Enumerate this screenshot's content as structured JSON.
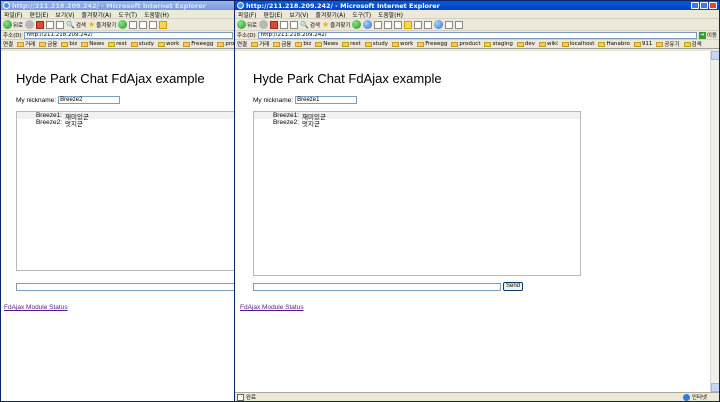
{
  "windows": [
    {
      "id": "back",
      "title": "http://211.218.209.242/ - Microsoft Internet Explorer",
      "menu": [
        "파일(F)",
        "편집(E)",
        "보기(V)",
        "즐겨찾기(A)",
        "도구(T)",
        "도움말(H)"
      ],
      "toolbar": {
        "back_label": "뒤로",
        "search_label": "검색",
        "favorites_label": "즐겨찾기"
      },
      "address": {
        "label": "주소(D)",
        "url": "http://211.218.209.242/"
      },
      "links": {
        "label": "연결",
        "items": [
          "거래",
          "금융",
          "biz",
          "News",
          "rest",
          "study",
          "work",
          "Freeegg",
          "product"
        ]
      },
      "page": {
        "heading": "Hyde Park Chat FdAjax example",
        "nickname_label": "My nickname:",
        "nickname_value": "Breeze2",
        "messages": [
          {
            "who": "Breeze1:",
            "text": "재미있군"
          },
          {
            "who": "Breeze2:",
            "text": "멋지군"
          }
        ],
        "status_link": "FdAjax Module Status"
      }
    },
    {
      "id": "front",
      "title": "http://211.218.209.242/ - Microsoft Internet Explorer",
      "menu": [
        "파일(F)",
        "편집(E)",
        "보기(V)",
        "즐겨찾기(A)",
        "도구(T)",
        "도움말(H)"
      ],
      "toolbar": {
        "back_label": "뒤로",
        "search_label": "검색",
        "favorites_label": "즐겨찾기"
      },
      "address": {
        "label": "주소(D)",
        "url": "http://211.218.209.242/",
        "go_label": "이동"
      },
      "links": {
        "label": "연결",
        "items": [
          "거래",
          "금융",
          "biz",
          "News",
          "rest",
          "study",
          "work",
          "Freeegg",
          "product",
          "staging",
          "dev",
          "wiki",
          "localhost",
          "Hanabro",
          "911",
          "공유기",
          "검색"
        ]
      },
      "page": {
        "heading": "Hyde Park Chat FdAjax example",
        "nickname_label": "My nickname:",
        "nickname_value": "Breeze1",
        "messages": [
          {
            "who": "Breeze1:",
            "text": "재미있군"
          },
          {
            "who": "Breeze2:",
            "text": "멋지군"
          }
        ],
        "send_label": "Send",
        "status_link": "FdAjax Module Status"
      },
      "statusbar": {
        "text": "완료",
        "zone": "인터넷"
      }
    }
  ]
}
